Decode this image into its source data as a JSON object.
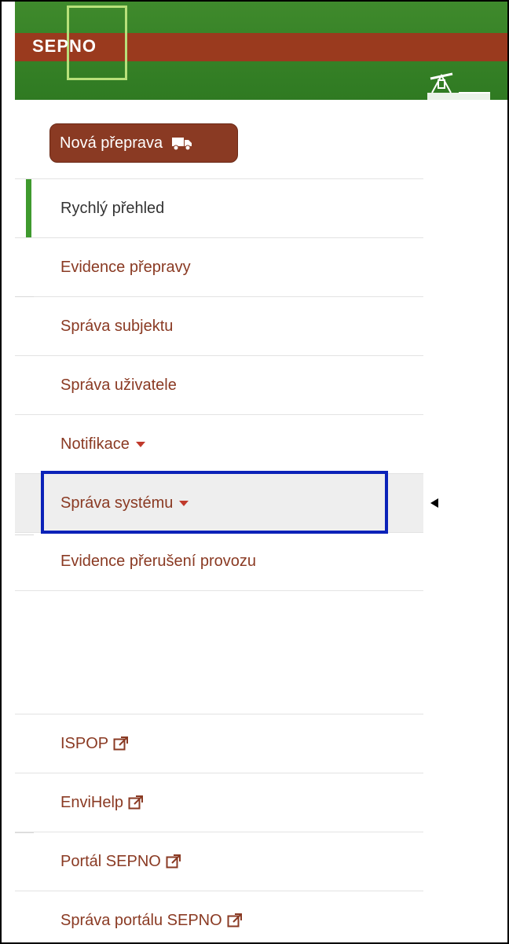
{
  "header": {
    "logo": "SEPNO"
  },
  "actions": {
    "new_transport_label": "Nová přeprava"
  },
  "menu": {
    "items": [
      {
        "label": "Rychlý přehled"
      },
      {
        "label": "Evidence přepravy"
      },
      {
        "label": "Správa subjektu"
      },
      {
        "label": "Správa uživatele"
      },
      {
        "label": "Notifikace"
      },
      {
        "label": "Správa systému"
      },
      {
        "label": "Evidence přerušení provozu"
      }
    ],
    "active_index": 0,
    "hovered_index": 5
  },
  "external_links": [
    {
      "label": "ISPOP"
    },
    {
      "label": "EnviHelp"
    },
    {
      "label": "Portál SEPNO"
    },
    {
      "label": "Správa portálu SEPNO"
    }
  ],
  "colors": {
    "brand_green": "#3f8a2c",
    "brand_brown": "#8a3a23",
    "active_indicator": "#3f9a2e",
    "highlight_border": "#0b22b8",
    "caret": "#c0392b"
  },
  "icons": {
    "truck": "truck-icon",
    "external": "external-link-icon",
    "dropdown": "caret-down-icon",
    "pointer": "pointer-arrow-icon"
  }
}
